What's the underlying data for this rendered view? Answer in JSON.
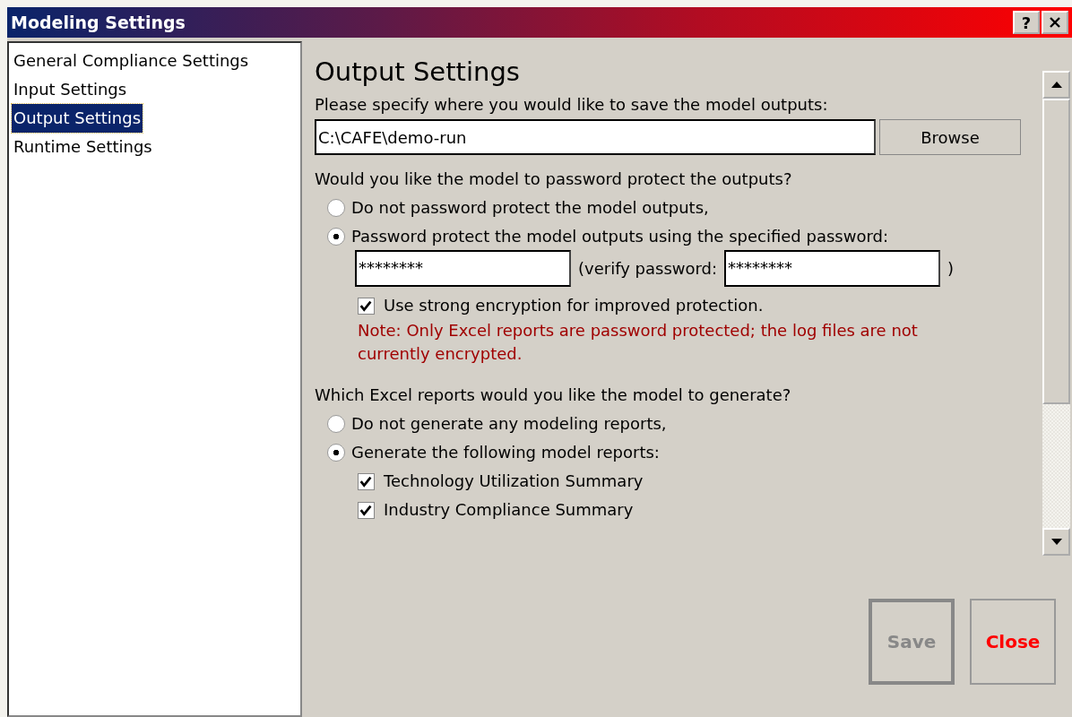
{
  "window": {
    "title": "Modeling Settings",
    "help_button": "?"
  },
  "sidebar": {
    "items": [
      {
        "label": "General Compliance Settings",
        "selected": false
      },
      {
        "label": "Input Settings",
        "selected": false
      },
      {
        "label": "Output Settings",
        "selected": true
      },
      {
        "label": "Runtime Settings",
        "selected": false
      }
    ]
  },
  "output_settings": {
    "title": "Output Settings",
    "location": {
      "prompt": "Please specify where you would like to save the model outputs:",
      "value": "C:\\CAFE\\demo-run",
      "browse_button": "Browse"
    },
    "password": {
      "question": "Would you like the model to password protect the outputs?",
      "options": [
        {
          "label": "Do not password protect the model outputs,",
          "selected": false
        },
        {
          "label": "Password protect the model outputs using the specified password:",
          "selected": true
        }
      ],
      "value": "********",
      "verify_label": "(verify password:",
      "verify_value": "********",
      "verify_close": ")",
      "strong_encryption": {
        "label": "Use strong encryption for improved protection.",
        "checked": true
      },
      "note": "Note:  Only Excel reports are password protected; the log files are not currently encrypted."
    },
    "reports": {
      "question": "Which Excel reports would you like the model to generate?",
      "options": [
        {
          "label": "Do not generate any modeling reports,",
          "selected": false
        },
        {
          "label": "Generate the following model reports:",
          "selected": true
        }
      ],
      "items": [
        {
          "label": "Technology Utilization Summary",
          "checked": true
        },
        {
          "label": "Industry Compliance Summary",
          "checked": true
        }
      ]
    }
  },
  "buttons": [
    {
      "label": "Save",
      "disabled": true,
      "kind": "save"
    },
    {
      "label": "Close",
      "disabled": false,
      "kind": "close"
    }
  ]
}
